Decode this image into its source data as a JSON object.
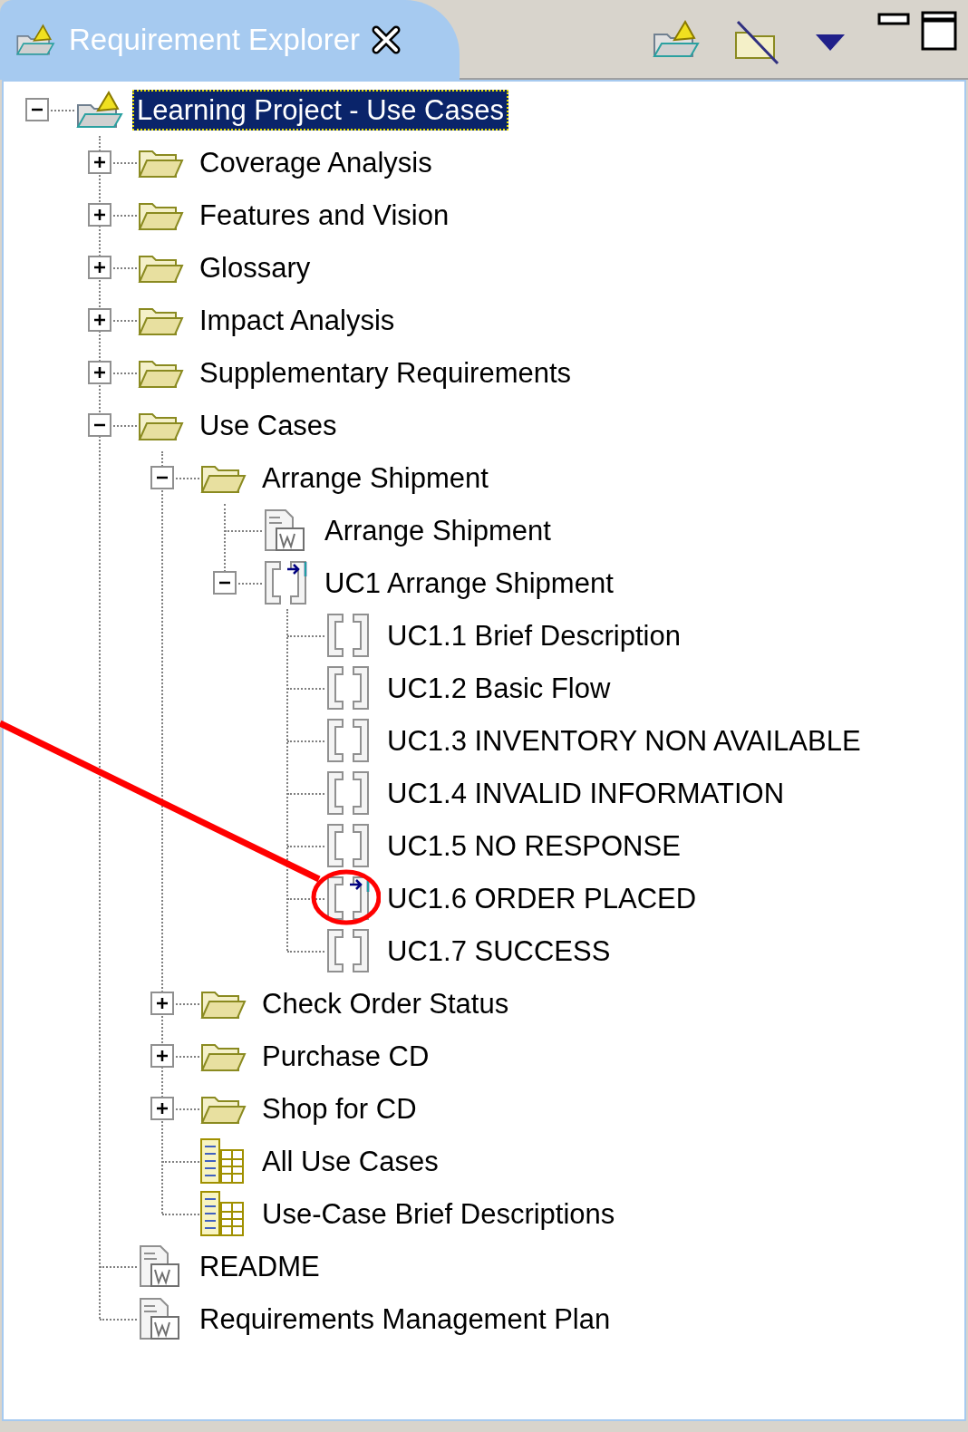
{
  "panel": {
    "title": "Requirement Explorer"
  },
  "tree": [
    {
      "label": "Learning Project - Use Cases",
      "kind": "project",
      "expanded": true,
      "selected": true,
      "children": [
        {
          "label": "Coverage Analysis",
          "kind": "folder",
          "expanded": false,
          "selected": false
        },
        {
          "label": "Features and Vision",
          "kind": "folder",
          "expanded": false,
          "selected": false
        },
        {
          "label": "Glossary",
          "kind": "folder",
          "expanded": false,
          "selected": false
        },
        {
          "label": "Impact Analysis",
          "kind": "folder",
          "expanded": false,
          "selected": false
        },
        {
          "label": "Supplementary Requirements",
          "kind": "folder",
          "expanded": false,
          "selected": false
        },
        {
          "label": "Use Cases",
          "kind": "folder",
          "expanded": true,
          "selected": false,
          "children": [
            {
              "label": "Arrange Shipment",
              "kind": "folder",
              "expanded": true,
              "selected": false,
              "children": [
                {
                  "label": "Arrange Shipment",
                  "kind": "document",
                  "selected": false
                },
                {
                  "label": "UC1 Arrange Shipment",
                  "kind": "requirement-linked",
                  "expanded": true,
                  "selected": false,
                  "children": [
                    {
                      "label": "UC1.1 Brief Description",
                      "kind": "requirement",
                      "selected": false
                    },
                    {
                      "label": "UC1.2 Basic Flow",
                      "kind": "requirement",
                      "selected": false
                    },
                    {
                      "label": "UC1.3 INVENTORY NON AVAILABLE",
                      "kind": "requirement",
                      "selected": false
                    },
                    {
                      "label": "UC1.4 INVALID INFORMATION",
                      "kind": "requirement",
                      "selected": false
                    },
                    {
                      "label": "UC1.5 NO RESPONSE",
                      "kind": "requirement",
                      "selected": false
                    },
                    {
                      "label": "UC1.6 ORDER PLACED",
                      "kind": "requirement-linked",
                      "selected": false
                    },
                    {
                      "label": "UC1.7 SUCCESS",
                      "kind": "requirement",
                      "selected": false
                    }
                  ]
                }
              ]
            },
            {
              "label": "Check Order Status",
              "kind": "folder",
              "expanded": false,
              "selected": false
            },
            {
              "label": "Purchase CD",
              "kind": "folder",
              "expanded": false,
              "selected": false
            },
            {
              "label": "Shop for CD",
              "kind": "folder",
              "expanded": false,
              "selected": false
            },
            {
              "label": "All Use Cases",
              "kind": "view",
              "selected": false
            },
            {
              "label": "Use-Case Brief Descriptions",
              "kind": "view",
              "selected": false
            }
          ]
        },
        {
          "label": "README",
          "kind": "document",
          "selected": false
        },
        {
          "label": "Requirements Management Plan",
          "kind": "document",
          "selected": false
        }
      ]
    }
  ]
}
